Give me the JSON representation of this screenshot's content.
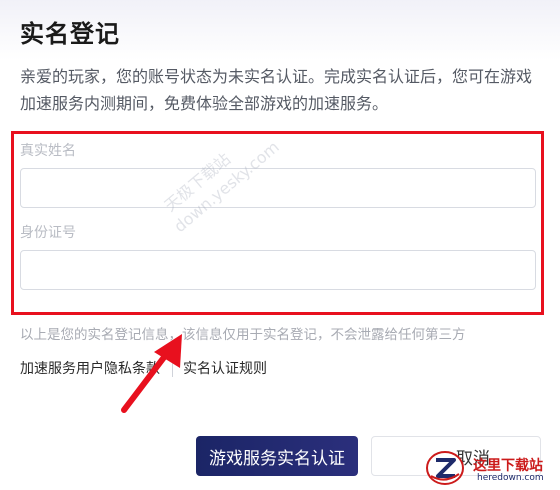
{
  "dialog": {
    "title": "实名登记",
    "description": "亲爱的玩家，您的账号状态为未实名认证。完成实名认证后，您可在游戏加速服务内测期间，免费体验全部游戏的加速服务。"
  },
  "form": {
    "name_label": "真实姓名",
    "name_value": "",
    "id_label": "身份证号",
    "id_value": ""
  },
  "note": "以上是您的实名登记信息，该信息仅用于实名登记，不会泄露给任何第三方",
  "links": {
    "privacy": "加速服务用户隐私条款",
    "rules": "实名认证规则"
  },
  "buttons": {
    "submit": "游戏服务实名认证",
    "cancel": "取消"
  },
  "watermark": {
    "line1": "天极下载站",
    "line2": "down.yesky.com"
  },
  "site_logo": {
    "name": "这里下载站",
    "domain": "heredown.com"
  },
  "colors": {
    "highlight": "#e8101e",
    "primary_button": "#1e2a6a",
    "arrow": "#e8101e"
  }
}
